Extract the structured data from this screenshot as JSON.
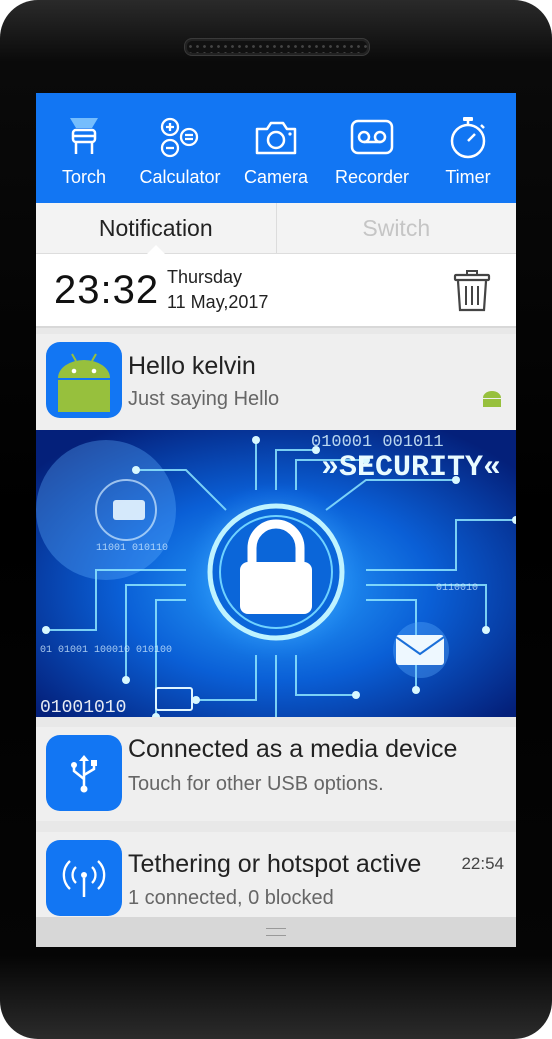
{
  "toolbar": {
    "items": [
      {
        "label": "Torch",
        "icon": "torch-icon"
      },
      {
        "label": "Calculator",
        "icon": "calculator-icon"
      },
      {
        "label": "Camera",
        "icon": "camera-icon"
      },
      {
        "label": "Recorder",
        "icon": "recorder-icon"
      },
      {
        "label": "Timer",
        "icon": "timer-icon"
      }
    ]
  },
  "tabs": [
    {
      "label": "Notification",
      "active": true
    },
    {
      "label": "Switch",
      "active": false
    }
  ],
  "clock": {
    "time": "23:32",
    "day": "Thursday",
    "date": "11 May,2017"
  },
  "notifications": [
    {
      "title": "Hello kelvin",
      "subtitle": "Just saying Hello",
      "icon": "android-icon",
      "badge": "android-small-icon"
    },
    {
      "banner_text": "»SECURITY«",
      "banner_binary": [
        "010001 001011",
        "01001010",
        "01 01001 100010 010100",
        "11001 010110",
        "0110010"
      ]
    },
    {
      "title": "Connected as a media device",
      "subtitle": "Touch for other USB options.",
      "icon": "usb-icon"
    },
    {
      "title": "Tethering or hotspot active",
      "subtitle": "1 connected, 0 blocked",
      "time": "22:54",
      "icon": "hotspot-icon"
    }
  ],
  "colors": {
    "accent": "#1276f3",
    "android": "#97c03d"
  }
}
